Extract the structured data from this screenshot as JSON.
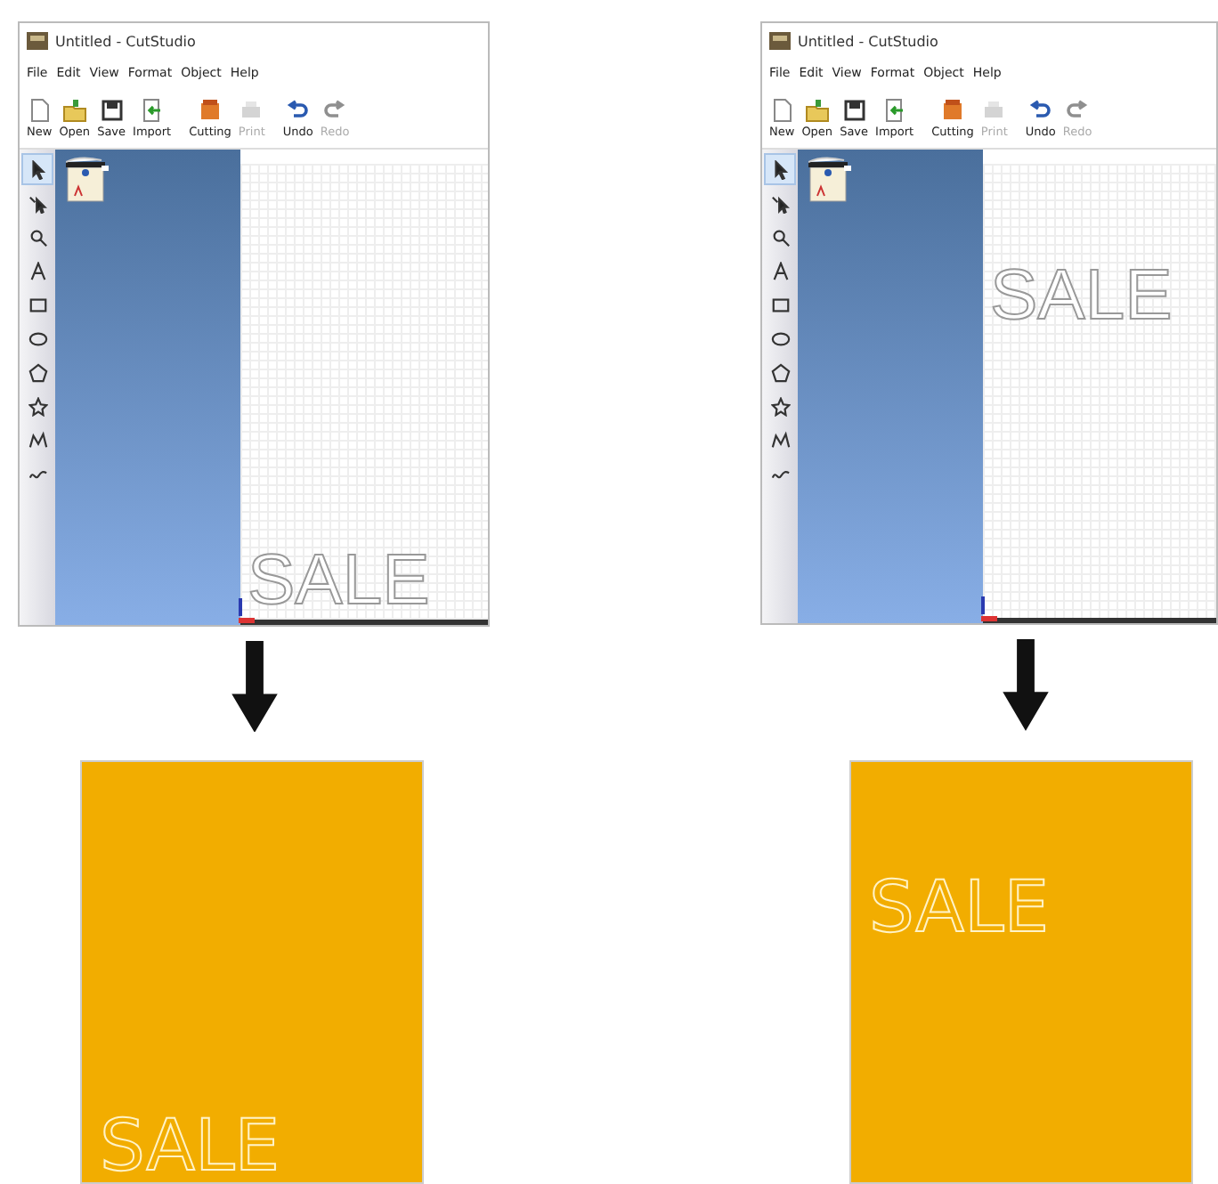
{
  "steps": [
    {
      "window": {
        "title": "Untitled - CutStudio",
        "menu": [
          "File",
          "Edit",
          "View",
          "Format",
          "Object",
          "Help"
        ],
        "toolbar": [
          {
            "label": "New",
            "disabled": false
          },
          {
            "label": "Open",
            "disabled": false
          },
          {
            "label": "Save",
            "disabled": false
          },
          {
            "label": "Import",
            "disabled": false
          },
          {
            "label": "Cutting",
            "disabled": false
          },
          {
            "label": "Print",
            "disabled": true
          },
          {
            "label": "Undo",
            "disabled": false
          },
          {
            "label": "Redo",
            "disabled": true
          }
        ],
        "tools": [
          {
            "selected": true
          },
          {
            "selected": false
          },
          {
            "selected": false
          },
          {
            "selected": false
          },
          {
            "selected": false
          },
          {
            "selected": false
          },
          {
            "selected": false
          },
          {
            "selected": false
          },
          {
            "selected": false
          },
          {
            "selected": false
          }
        ]
      },
      "canvas_text": {
        "text": "SALE",
        "kind": "bottom"
      },
      "result_text": {
        "text": "SALE",
        "kind": "bottom"
      }
    },
    {
      "window": {
        "title": "Untitled - CutStudio",
        "menu": [
          "File",
          "Edit",
          "View",
          "Format",
          "Object",
          "Help"
        ],
        "toolbar": [
          {
            "label": "New",
            "disabled": false
          },
          {
            "label": "Open",
            "disabled": false
          },
          {
            "label": "Save",
            "disabled": false
          },
          {
            "label": "Import",
            "disabled": false
          },
          {
            "label": "Cutting",
            "disabled": false
          },
          {
            "label": "Print",
            "disabled": true
          },
          {
            "label": "Undo",
            "disabled": false
          },
          {
            "label": "Redo",
            "disabled": true
          }
        ],
        "tools": [
          {
            "selected": true
          },
          {
            "selected": false
          },
          {
            "selected": false
          },
          {
            "selected": false
          },
          {
            "selected": false
          },
          {
            "selected": false
          },
          {
            "selected": false
          },
          {
            "selected": false
          },
          {
            "selected": false
          },
          {
            "selected": false
          }
        ]
      },
      "canvas_text": {
        "text": "SALE",
        "kind": "top"
      },
      "result_text": {
        "text": "SALE",
        "kind": "top"
      }
    }
  ]
}
